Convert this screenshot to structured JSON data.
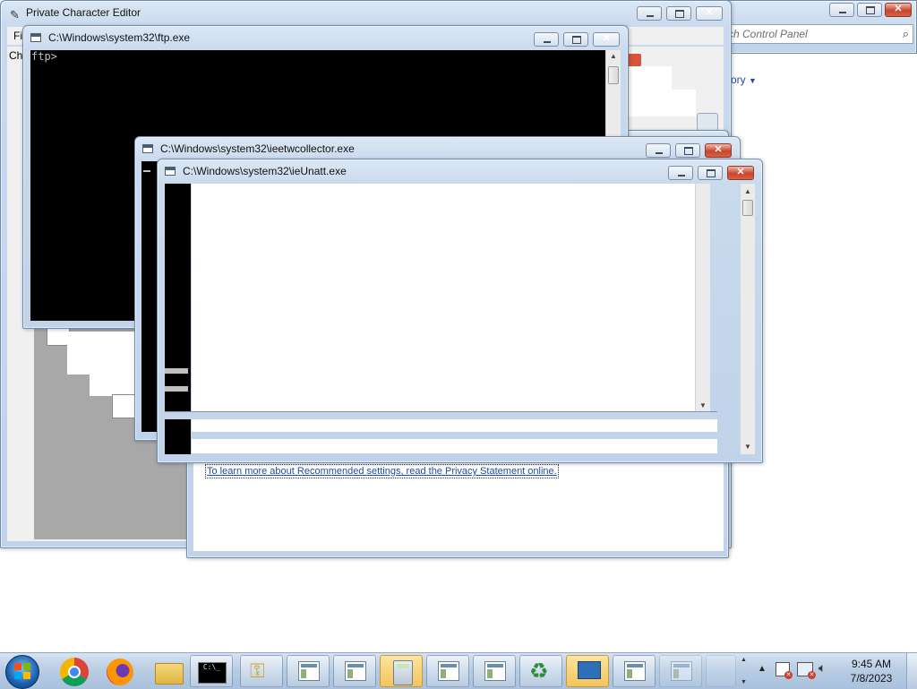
{
  "windows": {
    "private_char_editor": {
      "title": "Private Character Editor",
      "menu_first": "Fi",
      "label_fragment": "Ch"
    },
    "control_panel": {
      "search_placeholder": "ch Control Panel",
      "view_by": "ory"
    },
    "ftp": {
      "title": "C:\\Windows\\system32\\ftp.exe",
      "prompt": "ftp>"
    },
    "ieetw": {
      "title": "C:\\Windows\\system32\\ieetwcollector.exe"
    },
    "ieunatt": {
      "title": "C:\\Windows\\system32\\ieUnatt.exe"
    },
    "privacy": {
      "link": "To learn more about Recommended settings, read the Privacy Statement online."
    }
  },
  "taskbar": {
    "time": "9:45 AM",
    "date": "7/8/2023",
    "items": [
      "start-orb-icon",
      "chrome-icon",
      "firefox-icon",
      "explorer-icon",
      "cmd-icon",
      "keys-icon",
      "window-icon",
      "window-icon",
      "calculator-icon",
      "window-icon",
      "window-icon",
      "recycle-icon",
      "network-icon",
      "window-icon"
    ]
  },
  "colors": {
    "console_bg": "#000000",
    "aero_title": "#c9daee",
    "close_red": "#c9452f",
    "link": "#1b4fa6"
  }
}
